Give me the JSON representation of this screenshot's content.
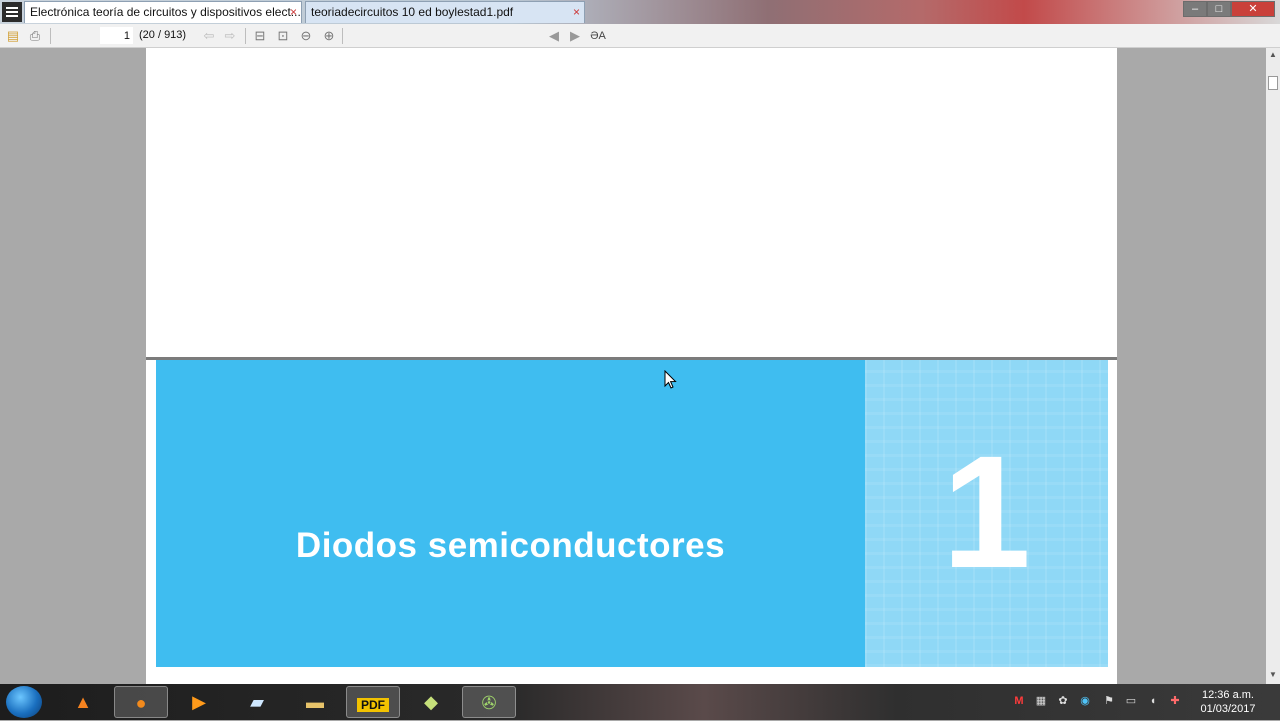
{
  "tabs": [
    {
      "label": "Electrónica teoría de circuitos y dispositivos elect...",
      "close": "×",
      "active": true
    },
    {
      "label": "teoriadecircuitos 10 ed boylestad1.pdf",
      "close": "×",
      "active": false
    }
  ],
  "window_controls": {
    "minimize": "–",
    "maximize": "□",
    "close": "✕"
  },
  "toolbar": {
    "page_input": "1",
    "page_count": "(20 / 913)",
    "icons": [
      "open-icon",
      "print-icon",
      "prev-page-icon",
      "next-page-icon",
      "fit-width-icon",
      "fit-page-icon",
      "zoom-out-icon",
      "zoom-in-icon",
      "back-icon",
      "forward-icon",
      "text-select-icon"
    ]
  },
  "document": {
    "chapter_title": "Diodos semiconductores",
    "chapter_number": "1",
    "band_color": "#3fbdf0"
  },
  "taskbar": {
    "apps": [
      "vlc-icon",
      "firefox-icon",
      "media-player-icon",
      "notepad-icon",
      "file-explorer-icon",
      "pdf-reader-icon",
      "sticky-notes-icon",
      "media-tool-icon"
    ],
    "tray": [
      "mcafee-icon",
      "network-icon",
      "antivirus-icon",
      "volume-icon",
      "flag-icon",
      "power-icon",
      "speaker-icon",
      "security-icon"
    ],
    "time": "12:36 a.m.",
    "date": "01/03/2017"
  }
}
